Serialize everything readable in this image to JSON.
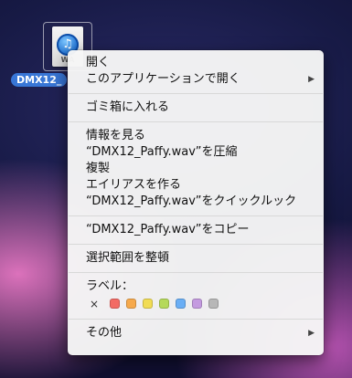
{
  "desktop": {
    "file_label": "DMX12_",
    "doc_badge": "WA"
  },
  "menu": {
    "group1": [
      {
        "label": "開く"
      },
      {
        "label": "このアプリケーションで開く",
        "submenu": true
      }
    ],
    "group2": [
      {
        "label": "ゴミ箱に入れる"
      }
    ],
    "group3": [
      {
        "label": "情報を見る"
      },
      {
        "label": "“DMX12_Paffy.wav”を圧縮"
      },
      {
        "label": "複製"
      },
      {
        "label": "エイリアスを作る"
      },
      {
        "label": "“DMX12_Paffy.wav”をクイックルック"
      }
    ],
    "group4": [
      {
        "label": "“DMX12_Paffy.wav”をコピー"
      }
    ],
    "group5": [
      {
        "label": "選択範囲を整頓"
      }
    ],
    "labels": {
      "heading": "ラベル：",
      "clear_symbol": "×",
      "colors": [
        "#f26b64",
        "#f6a94c",
        "#f1dc54",
        "#b5d95a",
        "#6aaef5",
        "#c49ae0",
        "#b7b7b7"
      ]
    },
    "group6": [
      {
        "label": "その他",
        "submenu": true
      }
    ],
    "submenu_glyph": "▶"
  }
}
